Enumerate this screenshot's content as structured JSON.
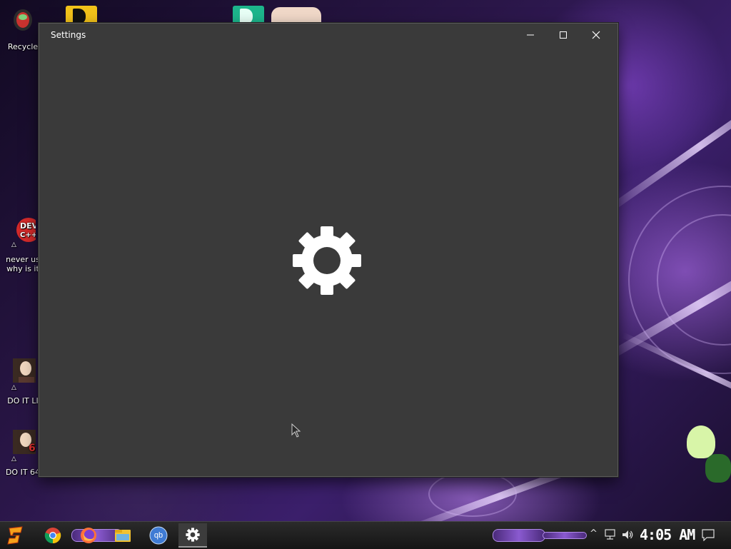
{
  "window": {
    "title": "Settings",
    "minimize_label": "Minimize",
    "maximize_label": "Maximize",
    "close_label": "Close"
  },
  "desktop_icons": [
    {
      "label": "Recycle",
      "icon": "recycle-bin-icon"
    },
    {
      "label": "never us",
      "label2": "why is it",
      "icon": "dev-cpp-icon"
    },
    {
      "label": "DO IT LI",
      "icon": "portrait-icon"
    },
    {
      "label": "DO IT 64",
      "icon": "portrait-icon"
    }
  ],
  "taskbar": {
    "items": [
      "start-icon",
      "chrome-icon",
      "firefox-icon",
      "file-explorer-icon",
      "qbittorrent-icon",
      "settings-icon"
    ],
    "qb_text": "qb",
    "clock": "4:05 AM"
  },
  "colors": {
    "window_bg": "#3a3a3a",
    "taskbar_bg": "#1e1e1e",
    "accent": "#8a5ad0"
  }
}
